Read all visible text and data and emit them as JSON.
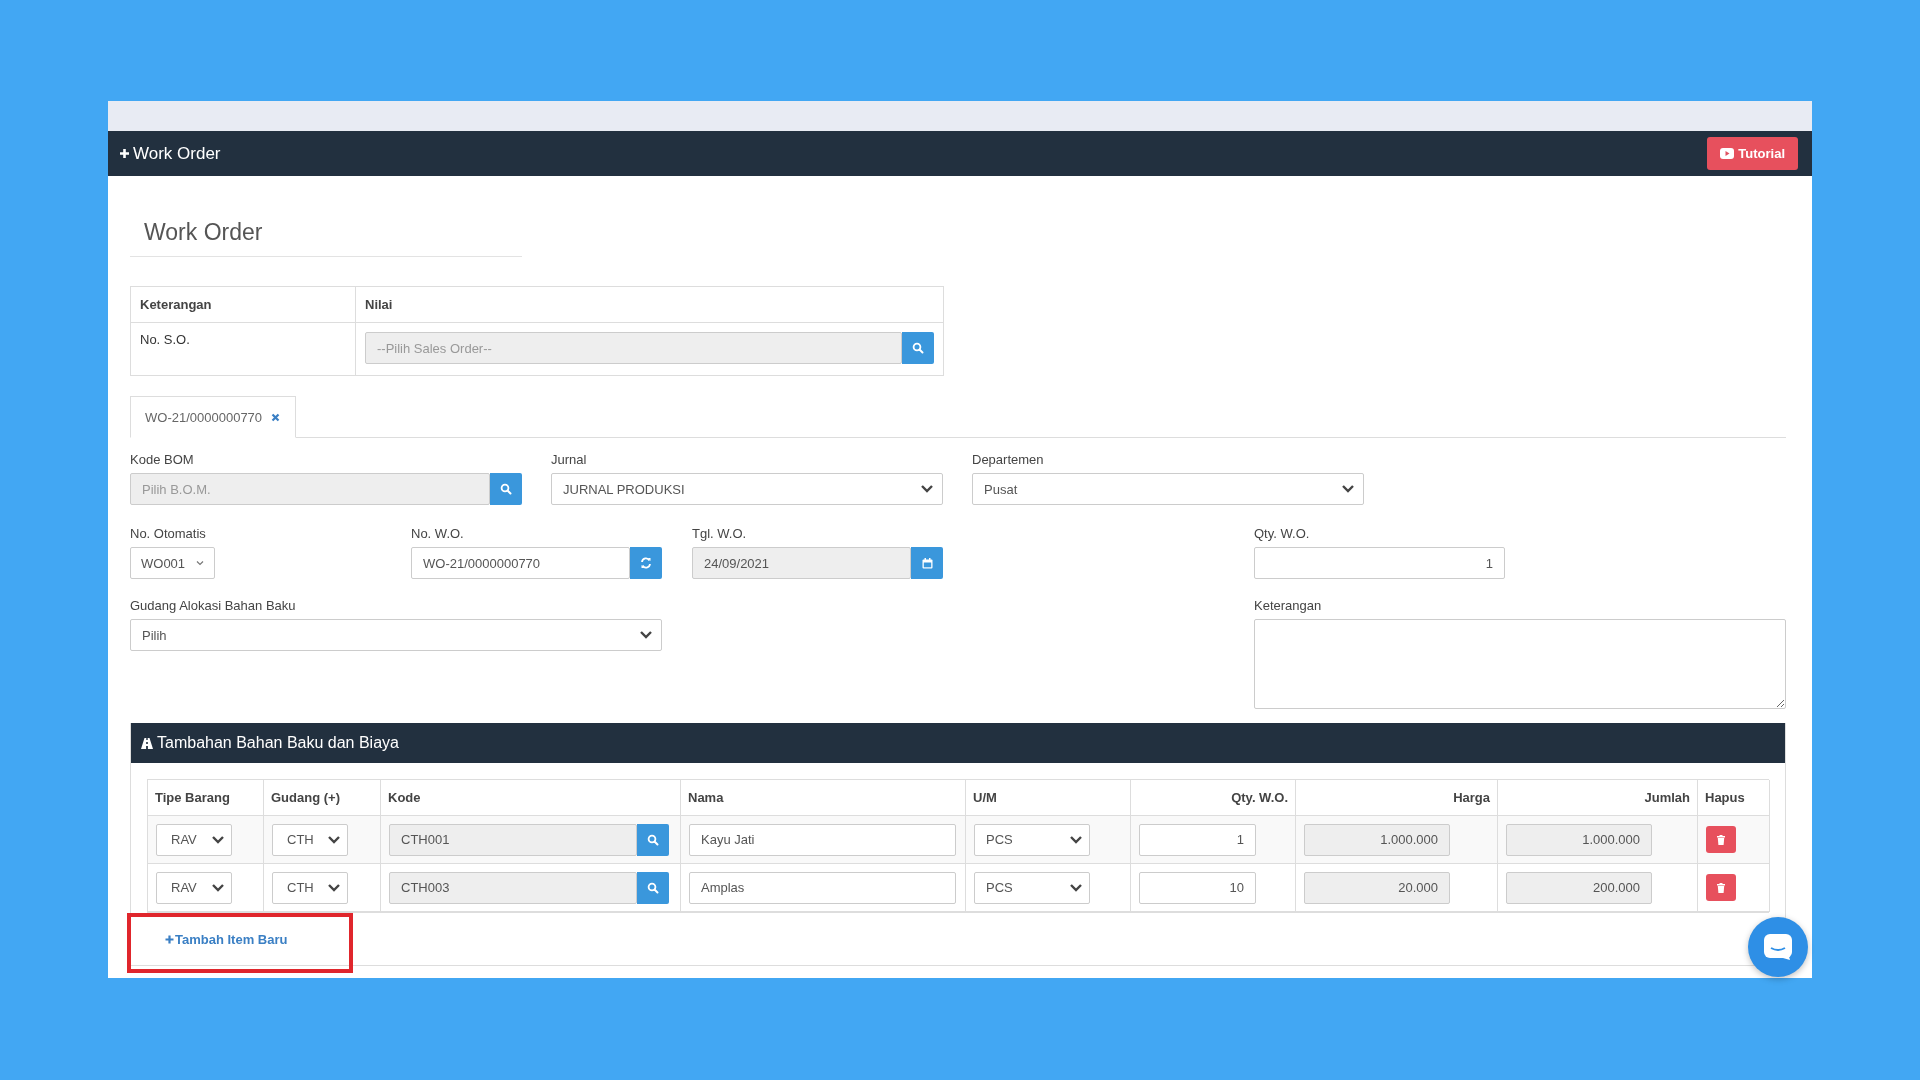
{
  "header": {
    "title": "Work Order",
    "tutorial_button": "Tutorial"
  },
  "form_title": "Work Order",
  "so_table": {
    "columns": [
      "Keterangan",
      "Nilai"
    ],
    "row": {
      "label": "No. S.O.",
      "placeholder": "--Pilih Sales Order--"
    }
  },
  "tabs": [
    {
      "label": "WO-21/0000000770",
      "selected": true
    }
  ],
  "kode_bom": {
    "label": "Kode BOM",
    "placeholder": "Pilih B.O.M.",
    "disabled": true
  },
  "jurnal": {
    "label": "Jurnal",
    "value": "JURNAL PRODUKSI"
  },
  "departemen": {
    "label": "Departemen",
    "value": "Pusat"
  },
  "no_otomatis": {
    "label": "No. Otomatis",
    "value": "WO001"
  },
  "no_wo": {
    "label": "No. W.O.",
    "value": "WO-21/0000000770",
    "disabled": false
  },
  "tgl_wo": {
    "label": "Tgl. W.O.",
    "value": "24/09/2021",
    "disabled": true
  },
  "qty_wo": {
    "label": "Qty. W.O.",
    "value": "1"
  },
  "gudang_alokasi": {
    "label": "Gudang Alokasi Bahan Baku",
    "value": "Pilih"
  },
  "keterangan": {
    "label": "Keterangan"
  },
  "section": {
    "title": "Tambahan Bahan Baku dan Biaya",
    "columns": [
      "Tipe Barang",
      "Gudang (+)",
      "Kode",
      "Nama",
      "U/M",
      "Qty. W.O.",
      "Harga",
      "Jumlah",
      "Hapus"
    ],
    "rows": [
      {
        "tipe": "RAV",
        "gudang": "CTH",
        "kode": "CTH001",
        "nama": "Kayu Jati",
        "um": "PCS",
        "qty": "1",
        "harga": "1.000.000",
        "jumlah": "1.000.000"
      },
      {
        "tipe": "RAV",
        "gudang": "CTH",
        "kode": "CTH003",
        "nama": "Amplas",
        "um": "PCS",
        "qty": "10",
        "harga": "20.000",
        "jumlah": "200.000"
      }
    ],
    "add_link": "Tambah Item Baru"
  }
}
